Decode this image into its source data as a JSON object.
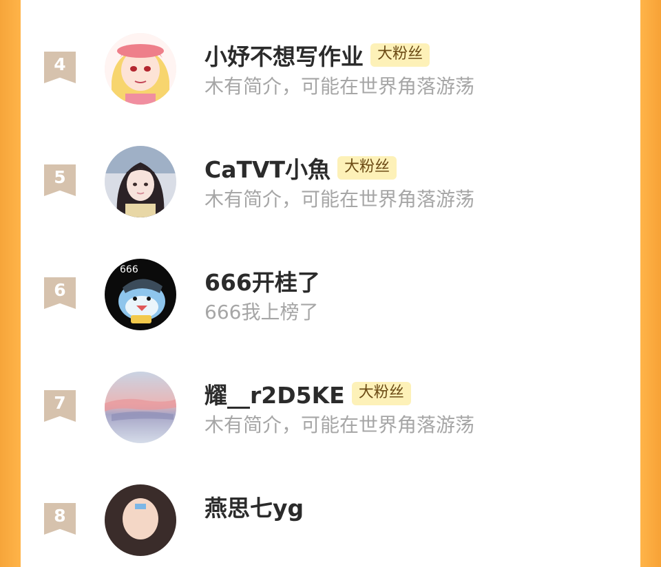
{
  "badge_label": "大粉丝",
  "colors": {
    "frame": "#ffb449",
    "rank_ribbon": "#d6c2ad",
    "badge_bg": "#fdf1b8",
    "name": "#2b2b2b",
    "bio": "#a6a6a6"
  },
  "rows": [
    {
      "rank": "4",
      "name": "小妤不想写作业",
      "bio": "木有简介，可能在世界角落游荡",
      "has_badge": true,
      "avatar_icon": "pink-hair-cartoon-avatar"
    },
    {
      "rank": "5",
      "name": "CaTVT小魚",
      "bio": "木有简介，可能在世界角落游荡",
      "has_badge": true,
      "avatar_icon": "girl-photo-avatar"
    },
    {
      "rank": "6",
      "name": "666开桂了",
      "bio": "666我上榜了",
      "has_badge": false,
      "avatar_icon": "shark-cartoon-avatar"
    },
    {
      "rank": "7",
      "name": "耀__r2D5KE",
      "bio": "木有简介，可能在世界角落游荡",
      "has_badge": true,
      "avatar_icon": "sunset-sky-avatar"
    },
    {
      "rank": "8",
      "name": "燕思七yg",
      "bio": "",
      "has_badge": false,
      "avatar_icon": "girl-face-avatar"
    }
  ]
}
